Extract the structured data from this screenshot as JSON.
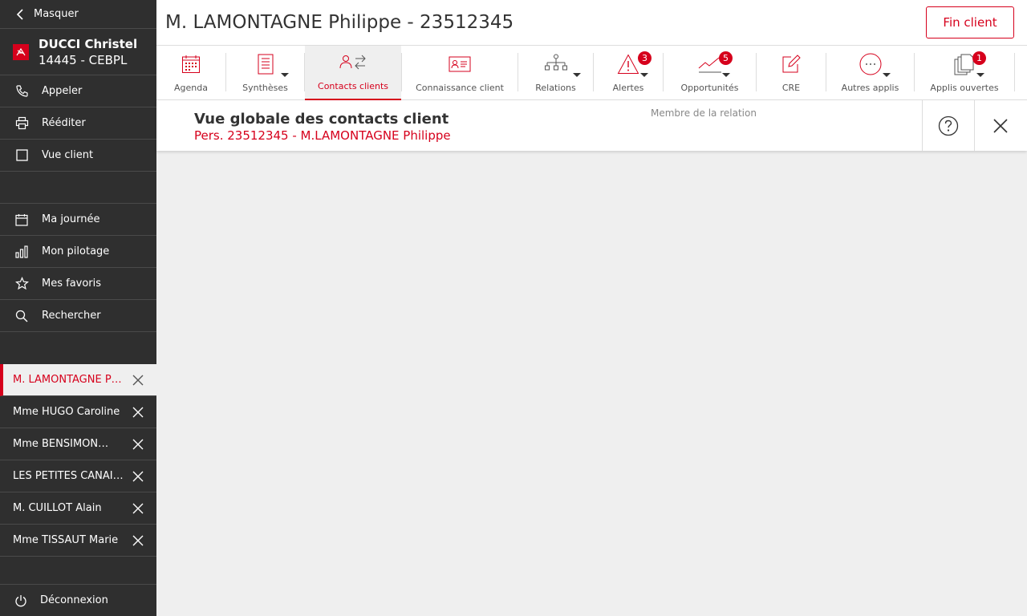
{
  "sidebar": {
    "hide_label": "Masquer",
    "user": {
      "name": "DUCCI Christel",
      "agency": "14445 - CEBPL"
    },
    "actions": [
      {
        "label": "Appeler",
        "icon": "phone-icon"
      },
      {
        "label": "Rééditer",
        "icon": "printer-icon"
      },
      {
        "label": "Vue client",
        "icon": "square-icon"
      }
    ],
    "nav": [
      {
        "label": "Ma journée",
        "icon": "calendar-icon"
      },
      {
        "label": "Mon pilotage",
        "icon": "bar-chart-icon"
      },
      {
        "label": "Mes favoris",
        "icon": "star-icon"
      },
      {
        "label": "Rechercher",
        "icon": "search-icon"
      }
    ],
    "clients": [
      {
        "label": "M. LAMONTAGNE Philippe",
        "active": true
      },
      {
        "label": "Mme HUGO Caroline",
        "active": false
      },
      {
        "label": "Mme BENSIMON Laurence",
        "active": false
      },
      {
        "label": "LES PETITES CANAILLES",
        "active": false
      },
      {
        "label": "M. CUILLOT Alain",
        "active": false
      },
      {
        "label": "Mme TISSAUT Marie",
        "active": false
      }
    ],
    "logout_label": "Déconnexion"
  },
  "header": {
    "title": "M. LAMONTAGNE Philippe - 23512345",
    "end_button": "Fin client"
  },
  "toolbar": {
    "items": [
      {
        "label": "Agenda",
        "icon": "calendar-grid-icon"
      },
      {
        "label": "Synthèses",
        "icon": "document-icon"
      },
      {
        "label": "Contacts clients",
        "icon": "contacts-exchange-icon"
      },
      {
        "label": "Connaissance client",
        "icon": "id-card-icon"
      },
      {
        "label": "Relations",
        "icon": "org-chart-icon"
      },
      {
        "label": "Alertes",
        "icon": "warning-icon",
        "badge": "3"
      },
      {
        "label": "Opportunités",
        "icon": "trend-line-icon",
        "badge": "5"
      },
      {
        "label": "CRE",
        "icon": "edit-icon"
      },
      {
        "label": "Autres applis",
        "icon": "more-icon"
      },
      {
        "label": "Applis ouvertes",
        "icon": "stacked-pages-icon",
        "badge": "1"
      }
    ]
  },
  "panel": {
    "title": "Vue globale des contacts client",
    "subtitle": "Pers. 23512345 - M.LAMONTAGNE Philippe",
    "member_label": "Membre de la relation"
  },
  "colors": {
    "accent": "#d6001c",
    "sidebar_bg": "#2f2f2f",
    "content_bg": "#efefef"
  }
}
